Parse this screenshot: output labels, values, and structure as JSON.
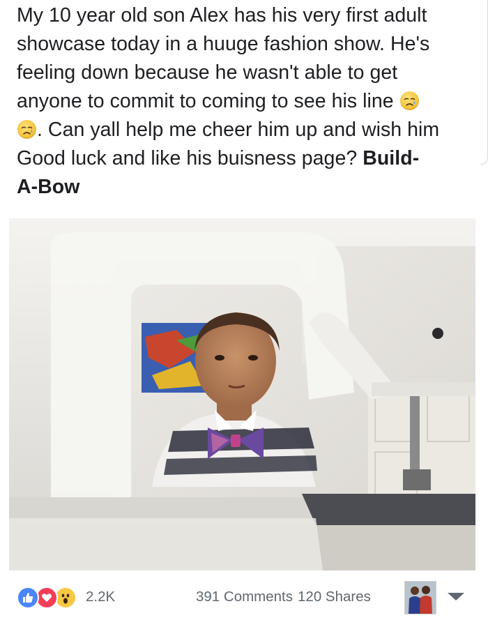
{
  "post": {
    "lines": [
      "My 10 year old son Alex has his very first adult",
      "showcase today in a huuge fashion show. He's",
      "feeling down because he wasn't able to get",
      "anyone to commit to coming to see his line",
      ". Can yall help me cheer him up and wish him",
      "Good luck and  like his buisness page?",
      "Build-",
      "A-Bow"
    ],
    "emoji_icons": [
      "crying-face-icon",
      "crying-face-icon"
    ]
  },
  "photo": {
    "subject": "photo-boy-behind-sewing-machine"
  },
  "footer": {
    "reaction_icons": [
      "like-icon",
      "love-icon",
      "wow-icon"
    ],
    "reaction_count": "2.2K",
    "comments": "391 Comments",
    "shares": "120 Shares"
  },
  "colors": {
    "text": "#1c1e21",
    "muted": "#606770",
    "like": "#4a86f7",
    "love": "#f33e58",
    "wow": "#f7c843"
  }
}
